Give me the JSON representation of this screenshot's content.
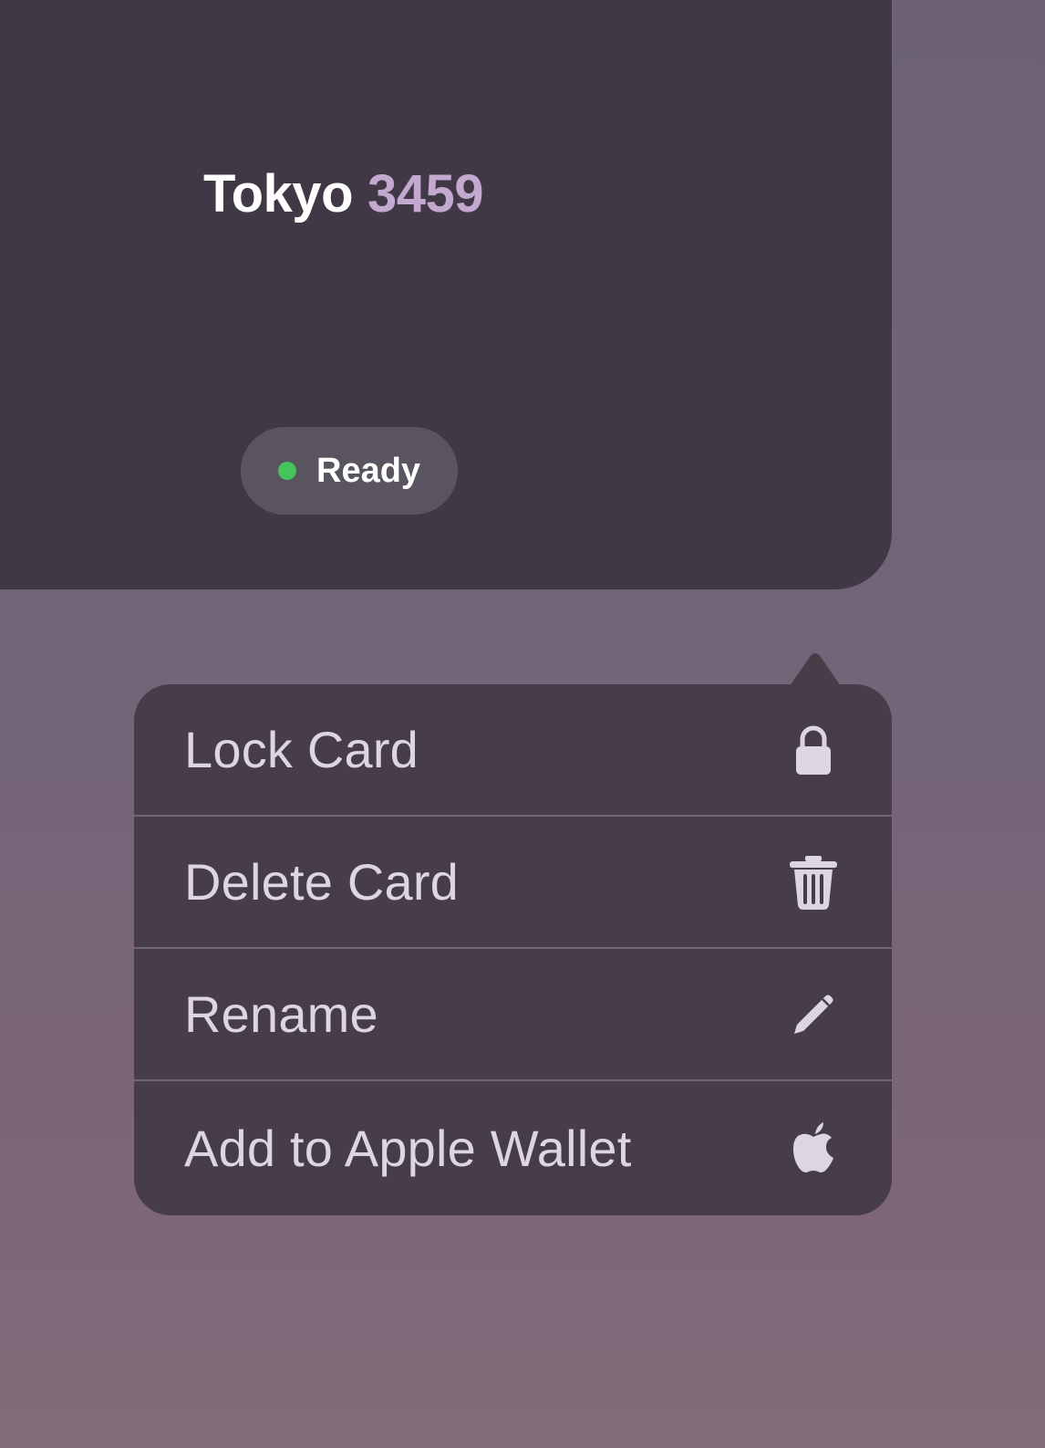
{
  "card": {
    "name": "Tokyo",
    "number": "3459",
    "status": {
      "label": "Ready",
      "dot_color": "#46c35a"
    }
  },
  "menu": {
    "items": [
      {
        "label": "Lock Card",
        "icon": "lock-icon"
      },
      {
        "label": "Delete Card",
        "icon": "trash-icon"
      },
      {
        "label": "Rename",
        "icon": "pencil-icon"
      },
      {
        "label": "Add to Apple Wallet",
        "icon": "apple-icon"
      }
    ]
  },
  "colors": {
    "card_background": "#403945",
    "menu_background": "#463d49",
    "accent_number": "#c3a8cf",
    "menu_text": "#ddd5e0"
  }
}
